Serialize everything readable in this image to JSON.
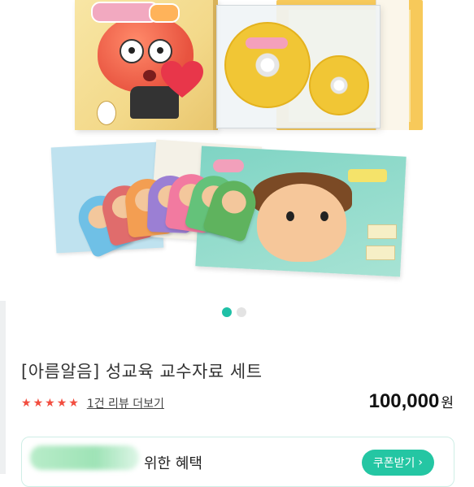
{
  "pagination": {
    "total": 2,
    "active_index": 0
  },
  "product": {
    "title": "[아름알음] 성교육 교수자료 세트",
    "rating_stars": 5,
    "review_link": "1건 리뷰 더보기",
    "price": "100,000",
    "price_unit": "원"
  },
  "benefit": {
    "text": "위한 혜택",
    "coupon_button": "쿠폰받기",
    "coupon_arrow": "›"
  },
  "colors": {
    "accent": "#24c6a3",
    "star": "#f24d3f",
    "dot_active": "#1fc0a6"
  },
  "icons": {
    "star": "star-icon",
    "chevron": "chevron-right-icon"
  }
}
